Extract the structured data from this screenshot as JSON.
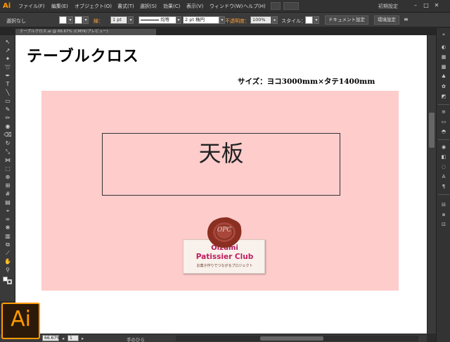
{
  "app": {
    "logo": "Ai",
    "workspace": "初期設定"
  },
  "menu": {
    "items": [
      "ファイル(F)",
      "編集(E)",
      "オブジェクト(O)",
      "書式(T)",
      "選択(S)",
      "効果(C)",
      "表示(V)",
      "ウィンドウ(W)",
      "ヘルプ(H)"
    ]
  },
  "controlbar": {
    "selection": "選択なし",
    "stroke_label": "線：",
    "stroke_weight": "1 pt",
    "stroke_style": "均等",
    "brush": "2 pt 楕円",
    "opacity_label": "不透明度：",
    "opacity_value": "100%",
    "style_label": "スタイル：",
    "doc_settings": "ドキュメント設定",
    "prefs": "環境設定",
    "colors": {
      "label_orange": "#ff9f3a"
    }
  },
  "document": {
    "tab_name": "テーブルクロス.ai @ 66.67% (CMYK/プレビュー)"
  },
  "artboard": {
    "title": "テーブルクロス",
    "size_label": "サイズ：ヨコ3000mm×タテ1400mm",
    "tabletop_label": "天板",
    "cloth_color": "#ffcccc"
  },
  "logo": {
    "seal_text": "OPC",
    "line1": "Oizumi",
    "line2": "Patissier Club",
    "tagline": "お菓子作りでつながるプロジェクト"
  },
  "status": {
    "zoom": "66.67%",
    "page": "1",
    "tool_name": "手のひら"
  },
  "big_icon": "Ai"
}
